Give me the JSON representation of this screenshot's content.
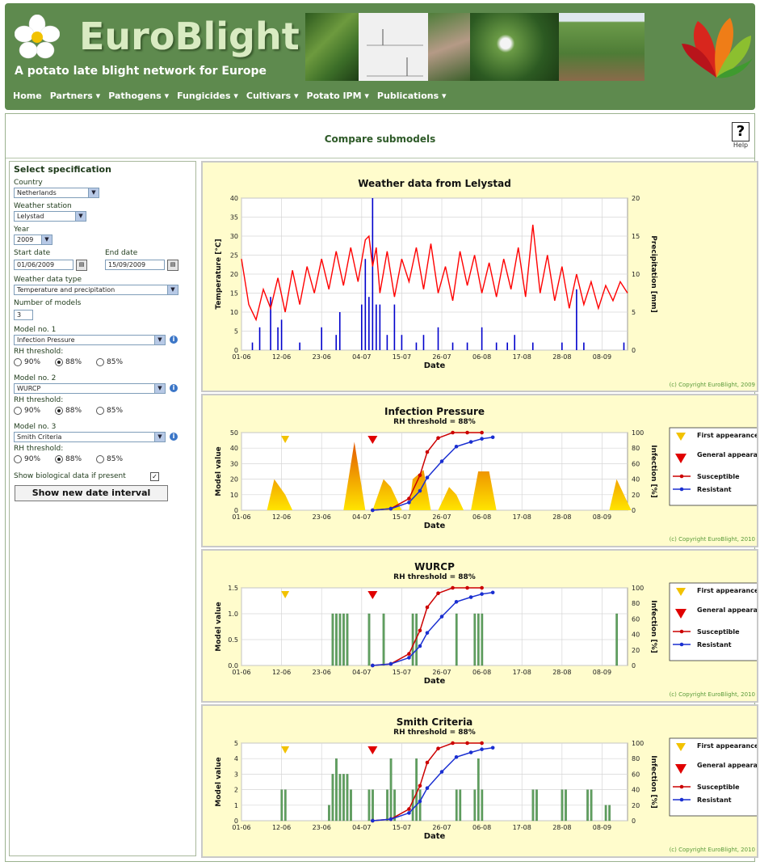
{
  "header": {
    "title": "EuroBlight",
    "subtitle": "A potato late blight network for Europe",
    "nav": [
      "Home",
      "Partners ▾",
      "Pathogens ▾",
      "Fungicides ▾",
      "Cultivars ▾",
      "Potato IPM ▾",
      "Publications ▾"
    ]
  },
  "page": {
    "title": "Compare submodels",
    "help_label": "Help",
    "help_glyph": "?"
  },
  "form": {
    "section_title": "Select specification",
    "country_label": "Country",
    "country_value": "Netherlands",
    "station_label": "Weather station",
    "station_value": "Lelystad",
    "year_label": "Year",
    "year_value": "2009",
    "start_label": "Start date",
    "start_value": "01/06/2009",
    "end_label": "End date",
    "end_value": "15/09/2009",
    "wtype_label": "Weather data type",
    "wtype_value": "Temperature and precipitation",
    "nmodels_label": "Number of models",
    "nmodels_value": "3",
    "model1_label": "Model no. 1",
    "model1_value": "Infection Pressure",
    "model2_label": "Model no. 2",
    "model2_value": "WURCP",
    "model3_label": "Model no. 3",
    "model3_value": "Smith Criteria",
    "rh_label": "RH threshold:",
    "rh_options": [
      "90%",
      "88%",
      "85%"
    ],
    "rh_selected": 1,
    "bio_label": "Show biological data if present",
    "show_button": "Show new date interval"
  },
  "colors": {
    "temp": "#ff0000",
    "precip": "#0000cc",
    "suscept": "#cc0000",
    "resist": "#1a2fd1",
    "bar_green": "#5f9f5f",
    "panel": "#fffccc",
    "first": "#f2c200",
    "general": "#e00000",
    "header": "#5e8a4e"
  },
  "chart_data": [
    {
      "type": "line",
      "title": "Weather data from Lelystad",
      "xlabel": "Date",
      "ylabel": "Temperature [°C]",
      "y2label": "Precipitation [mm]",
      "x_ticks": [
        "01-06",
        "12-06",
        "23-06",
        "04-07",
        "15-07",
        "26-07",
        "06-08",
        "17-08",
        "28-08",
        "08-09"
      ],
      "ylim": [
        0,
        40
      ],
      "y_ticks": [
        0,
        5,
        10,
        15,
        20,
        25,
        30,
        35,
        40
      ],
      "y2lim": [
        0,
        20
      ],
      "y2_ticks": [
        0,
        5,
        10,
        15,
        20
      ],
      "copyright": "(c) Copyright EuroBlight, 2009",
      "series": [
        {
          "name": "Temperature",
          "axis": "left",
          "x_days": [
            0,
            2,
            4,
            6,
            8,
            10,
            12,
            14,
            16,
            18,
            20,
            22,
            24,
            26,
            28,
            30,
            32,
            34,
            35,
            36,
            37,
            38,
            40,
            42,
            44,
            46,
            48,
            50,
            52,
            54,
            56,
            58,
            60,
            62,
            64,
            66,
            68,
            70,
            72,
            74,
            76,
            78,
            80,
            82,
            84,
            86,
            88,
            90,
            92,
            94,
            96,
            98,
            100,
            102,
            104,
            106
          ],
          "values": [
            24,
            12,
            8,
            16,
            11,
            19,
            10,
            21,
            12,
            22,
            15,
            24,
            16,
            26,
            17,
            27,
            18,
            29,
            30,
            22,
            27,
            15,
            26,
            14,
            24,
            18,
            27,
            16,
            28,
            15,
            22,
            13,
            26,
            17,
            25,
            15,
            23,
            14,
            24,
            16,
            27,
            14,
            33,
            15,
            25,
            13,
            22,
            11,
            20,
            12,
            18,
            11,
            17,
            13,
            18,
            15
          ]
        },
        {
          "name": "Precipitation",
          "axis": "right",
          "x_days": [
            3,
            5,
            8,
            10,
            11,
            16,
            22,
            26,
            27,
            33,
            34,
            35,
            36,
            37,
            38,
            40,
            42,
            44,
            48,
            50,
            54,
            58,
            62,
            66,
            70,
            73,
            75,
            80,
            88,
            92,
            94,
            105
          ],
          "values": [
            1,
            3,
            7,
            3,
            4,
            1,
            3,
            2,
            5,
            6,
            12,
            7,
            20,
            6,
            6,
            2,
            6,
            2,
            1,
            2,
            3,
            1,
            1,
            3,
            1,
            1,
            2,
            1,
            1,
            8,
            1,
            1
          ]
        }
      ]
    },
    {
      "type": "area",
      "title": "Infection Pressure",
      "subtitle": "RH threshold = 88%",
      "xlabel": "Date",
      "ylabel": "Model value",
      "y2label": "Infection [%]",
      "x_ticks": [
        "01-06",
        "12-06",
        "23-06",
        "04-07",
        "15-07",
        "26-07",
        "06-08",
        "17-08",
        "28-08",
        "08-09"
      ],
      "ylim": [
        0,
        50
      ],
      "y_ticks": [
        0,
        10,
        20,
        30,
        40,
        50
      ],
      "y2lim": [
        0,
        100
      ],
      "y2_ticks": [
        0,
        20,
        40,
        60,
        80,
        100
      ],
      "legend": [
        "First appearance",
        "General appearance",
        "Susceptible",
        "Resistant"
      ],
      "first_appearance_day": 12,
      "general_appearance_day": 36,
      "copyright": "(c) Copyright EuroBlight, 2010",
      "series": [
        {
          "name": "Model value",
          "x_days": [
            7,
            9,
            12,
            14,
            16,
            28,
            31,
            34,
            36,
            39,
            41,
            44,
            46,
            47,
            50,
            52,
            54,
            57,
            59,
            61,
            63,
            65,
            68,
            70,
            72,
            101,
            103,
            105,
            107
          ],
          "values": [
            0,
            20,
            10,
            0,
            0,
            0,
            44,
            0,
            0,
            20,
            15,
            0,
            0,
            20,
            26,
            0,
            0,
            15,
            10,
            0,
            0,
            25,
            25,
            0,
            0,
            0,
            20,
            10,
            0
          ]
        },
        {
          "name": "Susceptible",
          "x_days": [
            36,
            41,
            46,
            49,
            51,
            54,
            58,
            62,
            66
          ],
          "values": [
            0,
            2,
            15,
            45,
            75,
            93,
            100,
            100,
            100
          ]
        },
        {
          "name": "Resistant",
          "x_days": [
            36,
            41,
            46,
            49,
            51,
            55,
            59,
            63,
            66,
            69
          ],
          "values": [
            0,
            2,
            10,
            25,
            42,
            63,
            82,
            88,
            92,
            94
          ]
        }
      ]
    },
    {
      "type": "bar",
      "title": "WURCP",
      "subtitle": "RH threshold = 88%",
      "xlabel": "Date",
      "ylabel": "Model value",
      "y2label": "Infection [%]",
      "x_ticks": [
        "01-06",
        "12-06",
        "23-06",
        "04-07",
        "15-07",
        "26-07",
        "06-08",
        "17-08",
        "28-08",
        "08-09"
      ],
      "ylim": [
        0,
        1.5
      ],
      "y_ticks": [
        0.0,
        0.5,
        1.0,
        1.5
      ],
      "y2lim": [
        0,
        100
      ],
      "y2_ticks": [
        0,
        20,
        40,
        60,
        80,
        100
      ],
      "legend": [
        "First appearance",
        "General appearance",
        "Susceptible",
        "Resistant"
      ],
      "first_appearance_day": 12,
      "general_appearance_day": 36,
      "copyright": "(c) Copyright EuroBlight, 2010",
      "bars_days": [
        25,
        26,
        27,
        28,
        29,
        35,
        39,
        47,
        48,
        59,
        64,
        65,
        66,
        103
      ],
      "bars_values": [
        1,
        1,
        1,
        1,
        1,
        1,
        1,
        1,
        1,
        1,
        1,
        1,
        1,
        1
      ],
      "series": [
        {
          "name": "Susceptible",
          "x_days": [
            36,
            41,
            46,
            49,
            51,
            54,
            58,
            62,
            66
          ],
          "values": [
            0,
            2,
            15,
            45,
            75,
            93,
            100,
            100,
            100
          ]
        },
        {
          "name": "Resistant",
          "x_days": [
            36,
            41,
            46,
            49,
            51,
            55,
            59,
            63,
            66,
            69
          ],
          "values": [
            0,
            2,
            10,
            25,
            42,
            63,
            82,
            88,
            92,
            94
          ]
        }
      ]
    },
    {
      "type": "bar",
      "title": "Smith Criteria",
      "subtitle": "RH threshold = 88%",
      "xlabel": "Date",
      "ylabel": "Model value",
      "y2label": "Infection [%]",
      "x_ticks": [
        "01-06",
        "12-06",
        "23-06",
        "04-07",
        "15-07",
        "26-07",
        "06-08",
        "17-08",
        "28-08",
        "08-09"
      ],
      "ylim": [
        0,
        5
      ],
      "y_ticks": [
        0,
        1,
        2,
        3,
        4,
        5
      ],
      "y2lim": [
        0,
        100
      ],
      "y2_ticks": [
        0,
        20,
        40,
        60,
        80,
        100
      ],
      "legend": [
        "First appearance",
        "General appearance",
        "Susceptible",
        "Resistant"
      ],
      "first_appearance_day": 12,
      "general_appearance_day": 36,
      "copyright": "(c) Copyright EuroBlight, 2010",
      "bars_days": [
        11,
        12,
        24,
        25,
        26,
        27,
        28,
        29,
        30,
        35,
        36,
        40,
        41,
        42,
        47,
        48,
        49,
        59,
        60,
        64,
        65,
        66,
        80,
        81,
        88,
        89,
        95,
        96,
        100,
        101
      ],
      "bars_values": [
        2,
        2,
        1,
        3,
        4,
        3,
        3,
        3,
        2,
        2,
        2,
        2,
        4,
        2,
        2,
        4,
        2,
        2,
        2,
        2,
        4,
        2,
        2,
        2,
        2,
        2,
        2,
        2,
        1,
        1
      ],
      "series": [
        {
          "name": "Susceptible",
          "x_days": [
            36,
            41,
            46,
            49,
            51,
            54,
            58,
            62,
            66
          ],
          "values": [
            0,
            2,
            15,
            45,
            75,
            93,
            100,
            100,
            100
          ]
        },
        {
          "name": "Resistant",
          "x_days": [
            36,
            41,
            46,
            49,
            51,
            55,
            59,
            63,
            66,
            69
          ],
          "values": [
            0,
            2,
            10,
            25,
            42,
            63,
            82,
            88,
            92,
            94
          ]
        }
      ]
    }
  ]
}
